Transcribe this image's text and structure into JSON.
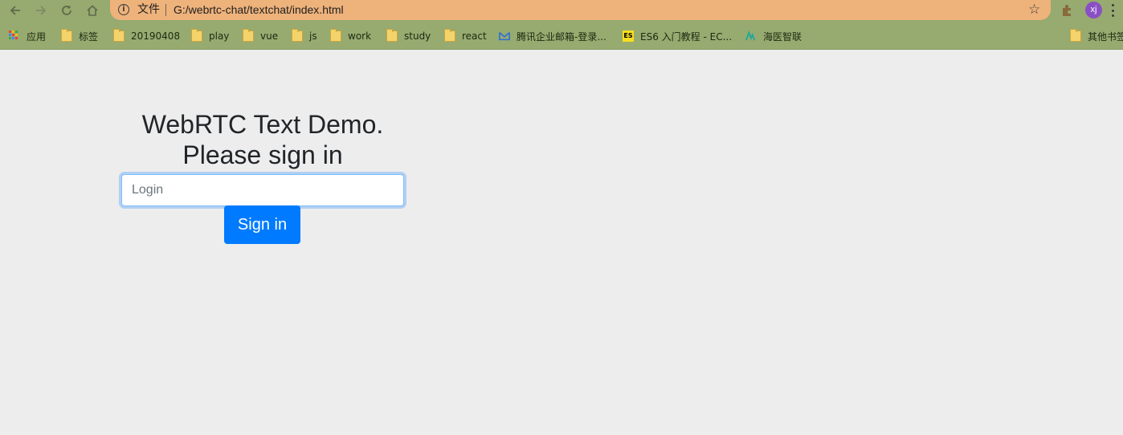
{
  "browser": {
    "omnibox": {
      "chip": "文件",
      "url": "G:/webrtc-chat/textchat/index.html"
    },
    "avatar_initials": "xj",
    "bookmarks": [
      {
        "label": "应用",
        "icon": "apps-grid-icon"
      },
      {
        "label": "标签",
        "icon": "folder-icon"
      },
      {
        "label": "20190408",
        "icon": "folder-icon"
      },
      {
        "label": "play",
        "icon": "folder-icon"
      },
      {
        "label": "vue",
        "icon": "folder-icon"
      },
      {
        "label": "js",
        "icon": "folder-icon"
      },
      {
        "label": "work",
        "icon": "folder-icon"
      },
      {
        "label": "study",
        "icon": "folder-icon"
      },
      {
        "label": "react",
        "icon": "folder-icon"
      },
      {
        "label": "腾讯企业邮箱-登录...",
        "icon": "tencent-mail-icon"
      },
      {
        "label": "ES6 入门教程 - EC...",
        "icon": "es6-icon"
      },
      {
        "label": "海医智联",
        "icon": "hyzl-icon"
      },
      {
        "label": "其他书签",
        "icon": "folder-icon"
      }
    ],
    "es6_badge": "ES",
    "colors": {
      "toolbar_bg": "#97aa70",
      "omnibox_bg": "#eeb27b",
      "avatar_bg": "#8a4fc5"
    }
  },
  "page": {
    "title_line1": "WebRTC Text Demo.",
    "title_line2": "Please sign in",
    "login_placeholder": "Login",
    "login_value": "",
    "signin_label": "Sign in",
    "colors": {
      "background": "#ededed",
      "primary": "#007bff",
      "heading": "#212529"
    }
  }
}
